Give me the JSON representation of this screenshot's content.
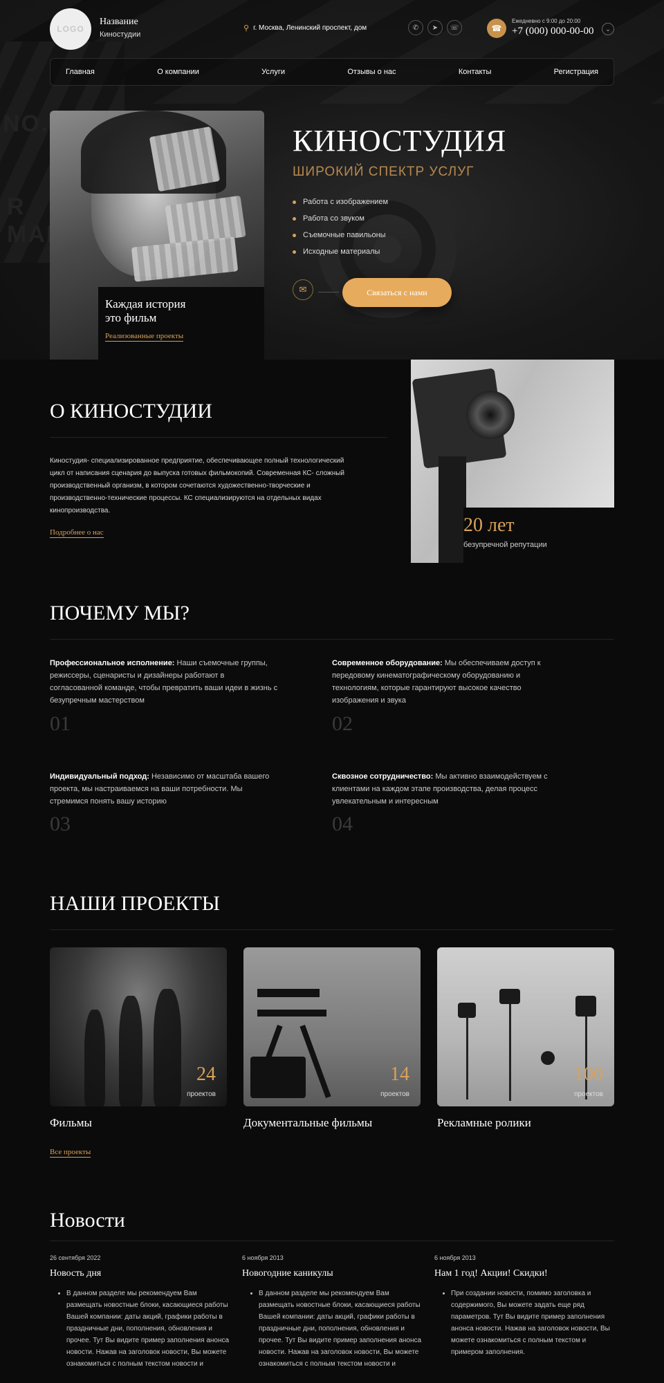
{
  "header": {
    "logo": "LOGO",
    "brand_line1": "Название",
    "brand_line2": "Киностудии",
    "address": "г. Москва, Ленинский проспект, дом",
    "hours": "Ежедневно с 9:00 до 20:00",
    "phone": "+7 (000) 000-00-00",
    "socials": [
      "whatsapp-icon",
      "telegram-icon",
      "viber-icon"
    ]
  },
  "nav": [
    "Главная",
    "О компании",
    "Услуги",
    "Отзывы о нас",
    "Контакты",
    "Регистрация"
  ],
  "hero": {
    "title": "КИНОСТУДИЯ",
    "subtitle": "ШИРОКИЙ СПЕКТР УСЛУГ",
    "list": [
      "Работа с изображением",
      "Работа со звуком",
      "Съемочные павильоны",
      "Исходные материалы"
    ],
    "cta": "Связаться с нами",
    "card_title_1": "Каждая история",
    "card_title_2": "это фильм",
    "card_link": "Реализованные проекты",
    "clapper_words": [
      "NO.",
      "R",
      "MAN"
    ]
  },
  "about": {
    "title": "О КИНОСТУДИИ",
    "text": "Киностудия- специализированное предприятие, обеспечивающее полный технологический цикл от написания сценария до выпуска готовых фильмокопий. Современная КС- сложный производственный организм, в котором сочетаются художественно-творческие и производственно-технические процессы. КС специализируются на отдельных видах кинопроизводства.",
    "link": "Подробнее о нас",
    "years": "20 лет",
    "years_sub": "безупречной репутации"
  },
  "why": {
    "title": "ПОЧЕМУ МЫ?",
    "items": [
      {
        "bold": "Профессиональное исполнение:",
        "text": " Наши съемочные группы, режиссеры, сценаристы и дизайнеры работают в согласованной команде, чтобы превратить ваши идеи в жизнь с безупречным мастерством",
        "num": "01"
      },
      {
        "bold": "Современное оборудование:",
        "text": " Мы обеспечиваем доступ к передовому кинематографическому оборудованию и технологиям, которые гарантируют высокое качество изображения и звука",
        "num": "02"
      },
      {
        "bold": "Индивидуальный подход:",
        "text": " Независимо от масштаба вашего проекта, мы настраиваемся на ваши потребности. Мы стремимся понять вашу историю",
        "num": "03"
      },
      {
        "bold": "Сквозное сотрудничество:",
        "text": " Мы активно взаимодействуем с клиентами на каждом этапе производства, делая процесс увлекательным и интересным",
        "num": "04"
      }
    ]
  },
  "projects": {
    "title": "НАШИ ПРОЕКТЫ",
    "items": [
      {
        "name": "Фильмы",
        "count": "24",
        "count_label": "проектов"
      },
      {
        "name": "Документальные фильмы",
        "count": "14",
        "count_label": "проектов"
      },
      {
        "name": "Рекламные ролики",
        "count": "100",
        "count_label": "проектов"
      }
    ],
    "link": "Все проекты"
  },
  "news": {
    "title": "Новости",
    "items": [
      {
        "date": "26 сентября 2022",
        "title": "Новость дня",
        "body": "В данном разделе мы рекомендуем Вам размещать новостные блоки, касающиеся работы Вашей компании: даты акций, графики работы в праздничные дни, пополнения, обновления и прочее. Тут Вы видите пример заполнения анонса новости. Нажав на заголовок новости, Вы можете ознакомиться с полным текстом новости и"
      },
      {
        "date": "6 ноября 2013",
        "title": "Новогодние каникулы",
        "body": "В данном разделе мы рекомендуем Вам размещать новостные блоки, касающиеся работы Вашей компании: даты акций, графики работы в праздничные дни, пополнения, обновления и прочее. Тут Вы видите пример заполнения анонса новости. Нажав на заголовок новости, Вы можете ознакомиться с полным текстом новости и"
      },
      {
        "date": "6 ноября 2013",
        "title": "Нам 1 год! Акции! Скидки!",
        "body": "При создании новости, помимо заголовка и содержимого, Вы можете задать еще ряд параметров. Тут Вы видите пример заполнения анонса новости. Нажав на заголовок новости, Вы можете ознакомиться с полным текстом и примером заполнения."
      }
    ]
  },
  "colors": {
    "accent": "#d9a25a",
    "background": "#0b0b0b",
    "button": "#e6ab5c"
  }
}
